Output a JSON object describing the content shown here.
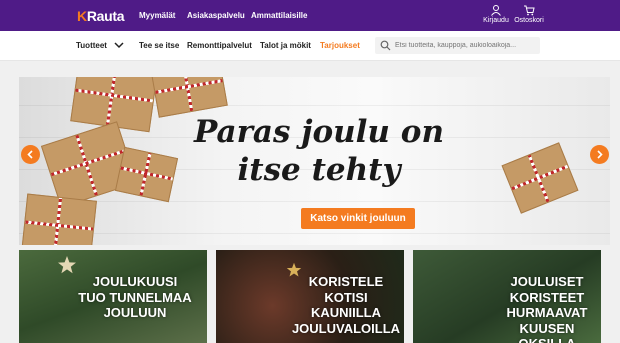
{
  "header": {
    "logo_text": "Rauta",
    "logo_letter": "K",
    "nav": [
      "Myymälät",
      "Asiakaspalvelu",
      "Ammattilaisille"
    ],
    "login_label": "Kirjaudu",
    "cart_label": "Ostoskori"
  },
  "mainnav": {
    "items": [
      "Tuotteet",
      "Tee se itse",
      "Remonttipalvelut",
      "Talot ja mökit",
      "Tarjoukset"
    ],
    "search_placeholder": "Etsi tuotteita, kauppoja, aukioloaikoja..."
  },
  "hero": {
    "headline_line1": "Paras joulu on",
    "headline_line2": "itse tehty",
    "cta_label": "Katso vinkit jouluun"
  },
  "tiles": [
    {
      "lines": [
        "JOULUKUUSI",
        "TUO TUNNELMAA",
        "JOULUUN"
      ]
    },
    {
      "lines": [
        "KORISTELE",
        "KOTISI",
        "KAUNIILLA",
        "JOULUVALOILLA"
      ]
    },
    {
      "lines": [
        "JOULUISET",
        "KORISTEET",
        "HURMAAVAT",
        "KUUSEN OKSILLA"
      ]
    }
  ],
  "colors": {
    "brand_purple": "#4f1b87",
    "accent_orange": "#f47b20"
  }
}
